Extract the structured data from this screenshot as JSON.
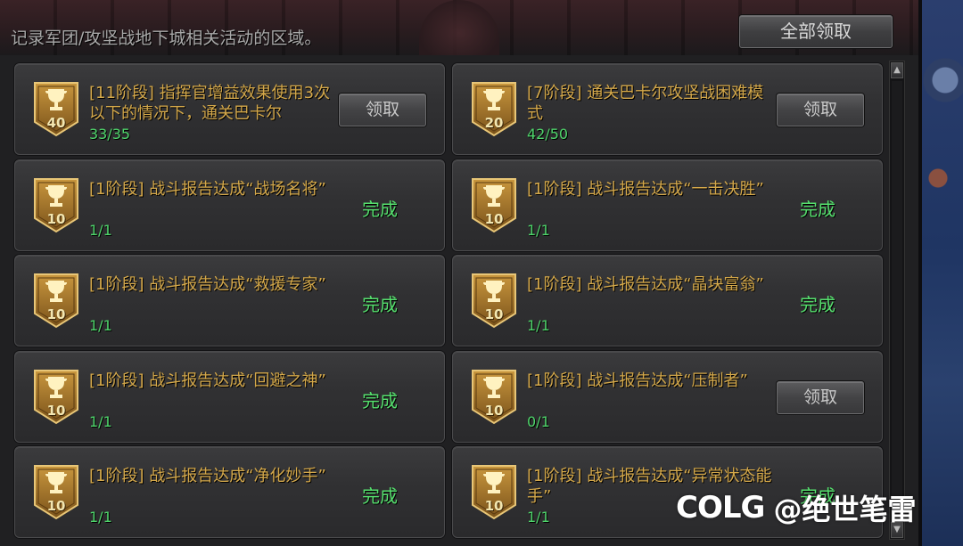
{
  "header": {
    "description": "记录军团/攻坚战地下城相关活动的区域。",
    "claim_all_label": "全部领取"
  },
  "labels": {
    "claim": "领取",
    "done": "完成"
  },
  "colors": {
    "title_gold": "#d4a84a",
    "progress_green": "#4ed36a",
    "done_green": "#56e06e",
    "badge_gold": "#a87a2c"
  },
  "achievements": [
    {
      "points": "40",
      "title": "[11阶段] 指挥官增益效果使用3次以下的情况下，通关巴卡尔",
      "progress": "33/35",
      "status": "claim"
    },
    {
      "points": "20",
      "title": "[7阶段] 通关巴卡尔攻坚战困难模式",
      "progress": "42/50",
      "status": "claim"
    },
    {
      "points": "10",
      "title": "[1阶段] 战斗报告达成“战场名将”",
      "progress": "1/1",
      "status": "done"
    },
    {
      "points": "10",
      "title": "[1阶段] 战斗报告达成“一击决胜”",
      "progress": "1/1",
      "status": "done"
    },
    {
      "points": "10",
      "title": "[1阶段] 战斗报告达成“救援专家”",
      "progress": "1/1",
      "status": "done"
    },
    {
      "points": "10",
      "title": "[1阶段] 战斗报告达成“晶块富翁”",
      "progress": "1/1",
      "status": "done"
    },
    {
      "points": "10",
      "title": "[1阶段] 战斗报告达成“回避之神”",
      "progress": "1/1",
      "status": "done"
    },
    {
      "points": "10",
      "title": "[1阶段] 战斗报告达成“压制者”",
      "progress": "0/1",
      "status": "claim"
    },
    {
      "points": "10",
      "title": "[1阶段] 战斗报告达成“净化妙手”",
      "progress": "1/1",
      "status": "done"
    },
    {
      "points": "10",
      "title": "[1阶段] 战斗报告达成“异常状态能手”",
      "progress": "1/1",
      "status": "done"
    }
  ],
  "watermark": {
    "logo": "COLG",
    "text": "@绝世笔雷"
  }
}
